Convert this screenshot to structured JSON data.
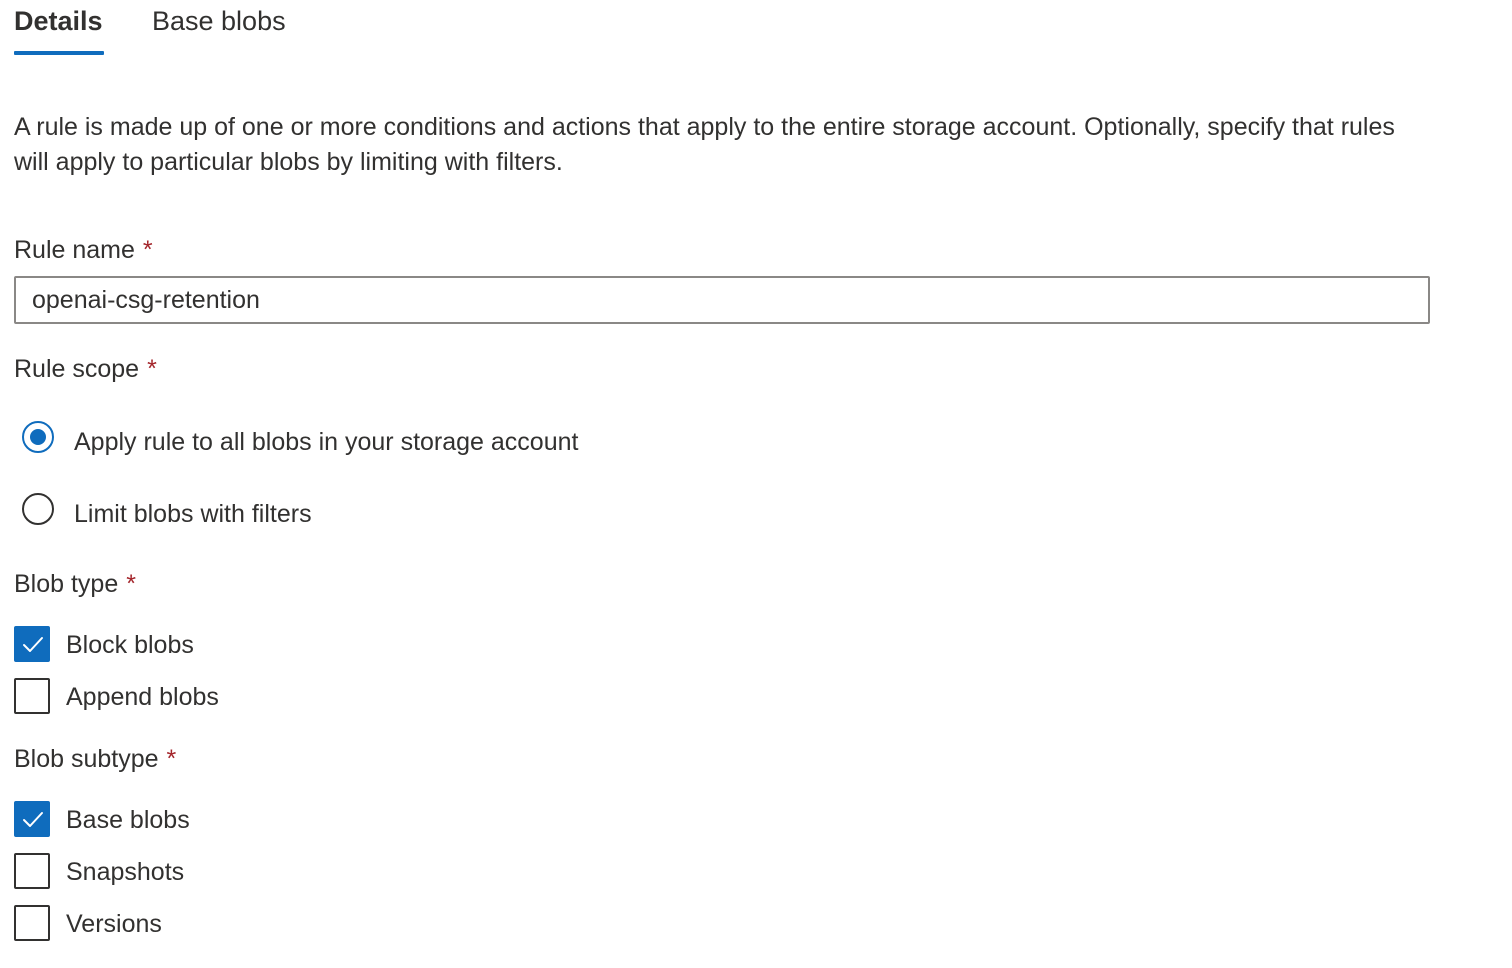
{
  "tabs": {
    "details": "Details",
    "base_blobs": "Base blobs"
  },
  "description": "A rule is made up of one or more conditions and actions that apply to the entire storage account. Optionally, specify that rules will apply to particular blobs by limiting with filters.",
  "rule_name": {
    "label": "Rule name",
    "required_mark": "*",
    "value": "openai-csg-retention"
  },
  "rule_scope": {
    "label": "Rule scope",
    "required_mark": "*",
    "options": [
      {
        "label": "Apply rule to all blobs in your storage account",
        "selected": true
      },
      {
        "label": "Limit blobs with filters",
        "selected": false
      }
    ]
  },
  "blob_type": {
    "label": "Blob type",
    "required_mark": "*",
    "options": [
      {
        "label": "Block blobs",
        "checked": true
      },
      {
        "label": "Append blobs",
        "checked": false
      }
    ]
  },
  "blob_subtype": {
    "label": "Blob subtype",
    "required_mark": "*",
    "options": [
      {
        "label": "Base blobs",
        "checked": true
      },
      {
        "label": "Snapshots",
        "checked": false
      },
      {
        "label": "Versions",
        "checked": false
      }
    ]
  },
  "colors": {
    "accent": "#0f6cbd",
    "required": "#a4262c",
    "text": "#323130"
  },
  "icons": {
    "checked_mark": "checkmark-icon"
  }
}
